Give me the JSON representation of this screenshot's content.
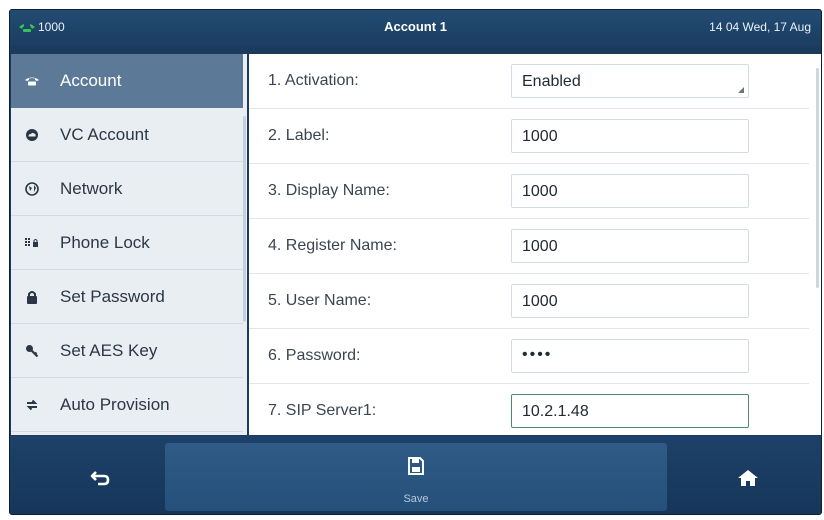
{
  "status_bar": {
    "extension": "1000",
    "title": "Account 1",
    "datetime": "14 04 Wed, 17 Aug"
  },
  "sidebar": {
    "items": [
      {
        "label": "Account",
        "icon": "phone-icon",
        "active": true
      },
      {
        "label": "VC Account",
        "icon": "cloud-icon",
        "active": false
      },
      {
        "label": "Network",
        "icon": "globe-icon",
        "active": false
      },
      {
        "label": "Phone Lock",
        "icon": "keypad-lock-icon",
        "active": false
      },
      {
        "label": "Set Password",
        "icon": "padlock-icon",
        "active": false
      },
      {
        "label": "Set AES Key",
        "icon": "key-icon",
        "active": false
      },
      {
        "label": "Auto Provision",
        "icon": "sync-icon",
        "active": false
      }
    ]
  },
  "settings": {
    "rows": [
      {
        "label": "1. Activation:",
        "value": "Enabled",
        "type": "dropdown"
      },
      {
        "label": "2. Label:",
        "value": "1000",
        "type": "text"
      },
      {
        "label": "3. Display Name:",
        "value": "1000",
        "type": "text"
      },
      {
        "label": "4. Register Name:",
        "value": "1000",
        "type": "text"
      },
      {
        "label": "5. User Name:",
        "value": "1000",
        "type": "text"
      },
      {
        "label": "6. Password:",
        "value": "••••",
        "type": "password"
      },
      {
        "label": "7. SIP Server1:",
        "value": "10.2.1.48",
        "type": "text",
        "focused": true
      }
    ]
  },
  "bottom_bar": {
    "back_icon": "back-arrow-icon",
    "save_label": "Save",
    "save_icon": "save-icon",
    "home_icon": "home-icon"
  },
  "colors": {
    "frame": "#1a3a5e",
    "sidebar_active": "#5c7a98",
    "sidebar_bg": "#e9eef3",
    "focus_border": "#4f8a6d"
  }
}
